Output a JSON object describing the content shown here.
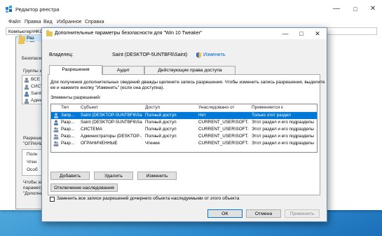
{
  "registry": {
    "title": "Редактор реестра",
    "menu": [
      "Файл",
      "Правка",
      "Вид",
      "Избранное",
      "Справка"
    ],
    "address": "Компьютер\\HKC",
    "bg_dialog": {
      "title": "Раз",
      "security_label": "Безопасност",
      "groups_label": "Группы и",
      "entries": [
        "ВСЕ",
        "СИСТ",
        "Saint",
        "Адми"
      ],
      "perm_label": "Разрешени",
      "perm_label2": "\"ОГРАНИ",
      "perm_rows": [
        "Полн",
        "Чтен",
        "Особ"
      ],
      "footer1": "Чтобы зад",
      "footer2": "параметр",
      "footer3": "\"Дополни"
    }
  },
  "dialog": {
    "title": "Дополнительные параметры безопасности  для \"Win 10 Tweaker\"",
    "owner_label": "Владелец:",
    "owner_value": "Saint (DESKTOP-5UNTBF6\\Saint)",
    "owner_change": "Изменить",
    "tabs": [
      "Разрешения",
      "Аудит",
      "Действующие права доступа"
    ],
    "info_text1": "Для получения дополнительных сведений дважды щелкните запись разрешения. Чтобы изменить запись разрешения, выделите",
    "info_text2": "ее и нажмите кнопку \"Изменить\" (если она доступна).",
    "entries_label": "Элементы разрешений:",
    "columns": [
      "Тип",
      "Субъект",
      "Доступ",
      "Унаследовано от",
      "Применяется к"
    ],
    "rows": [
      {
        "type": "Запр...",
        "subject": "Saint (DESKTOP-5UNTBF6\\Sai...",
        "access": "Полный доступ",
        "inherited": "Нет",
        "applies": "Только этот раздел"
      },
      {
        "type": "Разр...",
        "subject": "Saint (DESKTOP-5UNTBF6\\Sai...",
        "access": "Полный доступ",
        "inherited": "CURRENT_USER\\SOFT...",
        "applies": "Этот раздел и его подразделы"
      },
      {
        "type": "Разр...",
        "subject": "СИСТЕМА",
        "access": "Полный доступ",
        "inherited": "CURRENT_USER\\SOFT...",
        "applies": "Этот раздел и его подразделы"
      },
      {
        "type": "Разр...",
        "subject": "Администраторы (DESKTOP-...",
        "access": "Полный доступ",
        "inherited": "CURRENT_USER\\SOFT...",
        "applies": "Этот раздел и его подразделы"
      },
      {
        "type": "Разр...",
        "subject": "ОГРАНИЧЕННЫЕ",
        "access": "Чтение",
        "inherited": "CURRENT_USER\\SOFT...",
        "applies": "Этот раздел и его подразделы"
      }
    ],
    "buttons": {
      "add": "Добавить",
      "remove": "Удалить",
      "edit": "Изменить",
      "disable_inheritance": "Отключение наследования",
      "ok": "OK",
      "cancel": "Отмена",
      "apply": "Применить"
    },
    "replace_checkbox": "Заменить все записи разрешений дочернего объекта наследуемыми от этого объекта"
  },
  "colors": {
    "selection": "#0078d7",
    "link": "#0066cc"
  }
}
